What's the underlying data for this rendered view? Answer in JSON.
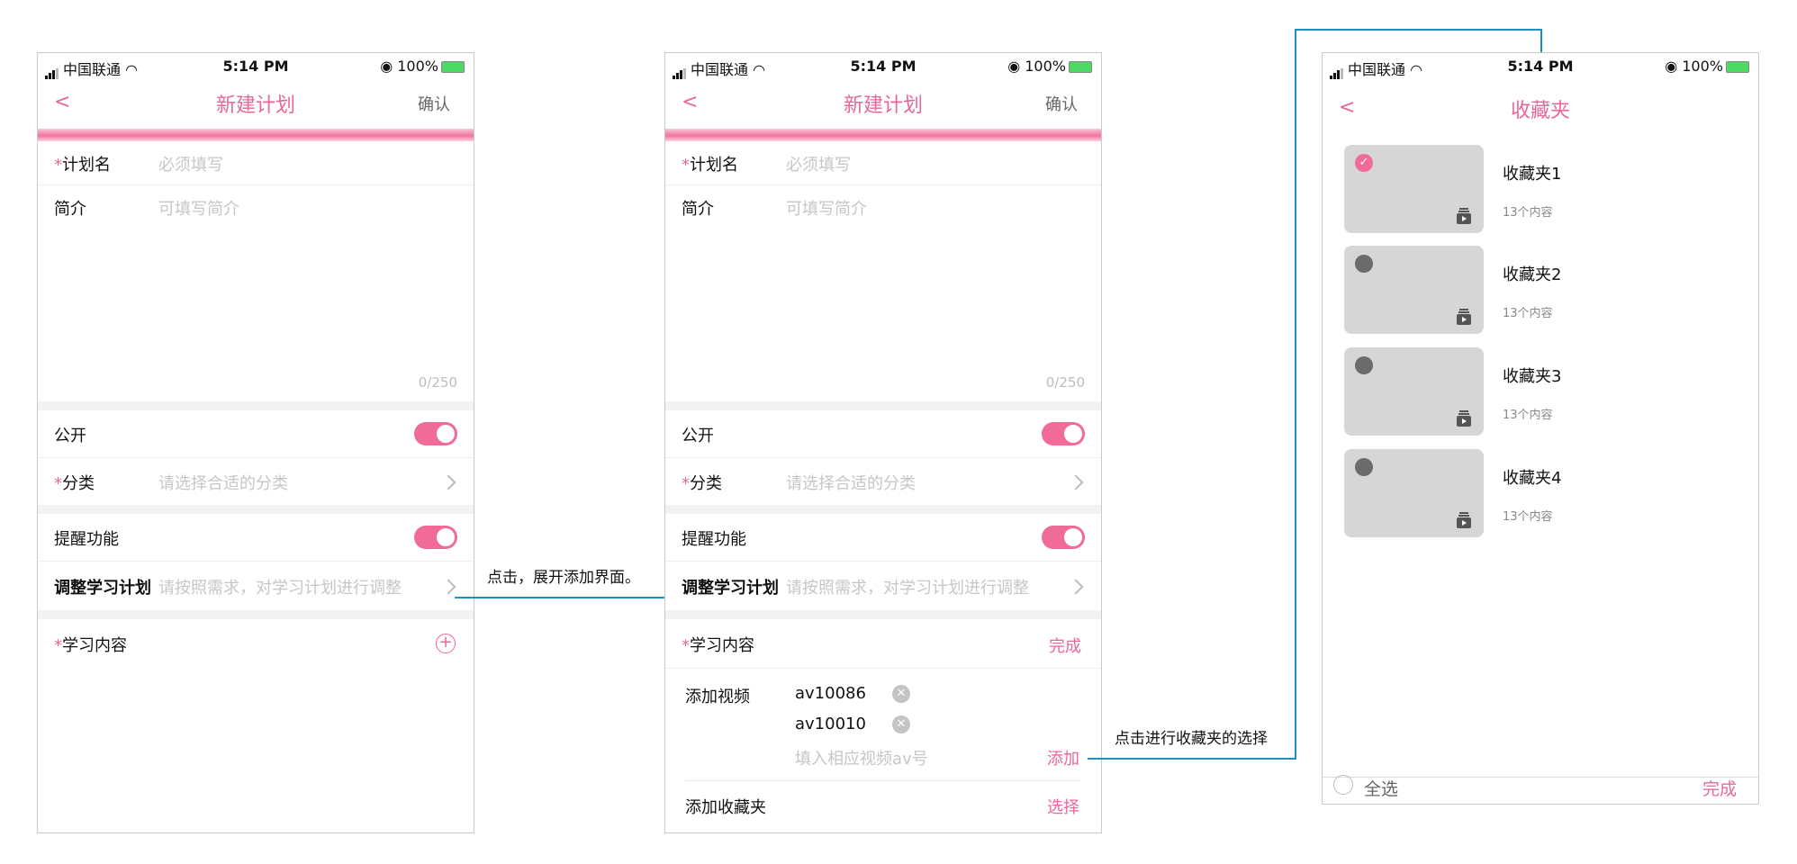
{
  "status_bar": {
    "carrier": "中国联通",
    "time": "5:14 PM",
    "battery": "100%"
  },
  "screen1": {
    "title": "新建计划",
    "confirm": "确认",
    "plan_name_label": "计划名",
    "plan_name_placeholder": "必须填写",
    "intro_label": "简介",
    "intro_placeholder": "可填写简介",
    "counter": "0/250",
    "public_label": "公开",
    "category_label": "分类",
    "category_placeholder": "请选择合适的分类",
    "reminder_label": "提醒功能",
    "adjust_label": "调整学习计划",
    "adjust_placeholder": "请按照需求，对学习计划进行调整",
    "content_label": "学习内容"
  },
  "screen2": {
    "title": "新建计划",
    "confirm": "确认",
    "plan_name_label": "计划名",
    "plan_name_placeholder": "必须填写",
    "intro_label": "简介",
    "intro_placeholder": "可填写简介",
    "counter": "0/250",
    "public_label": "公开",
    "category_label": "分类",
    "category_placeholder": "请选择合适的分类",
    "reminder_label": "提醒功能",
    "adjust_label": "调整学习计划",
    "adjust_placeholder": "请按照需求，对学习计划进行调整",
    "content_label": "学习内容",
    "done": "完成",
    "add_video_label": "添加视频",
    "videos": [
      "av10086",
      "av10010"
    ],
    "video_input_placeholder": "填入相应视频av号",
    "add": "添加",
    "add_folder_label": "添加收藏夹",
    "select": "选择"
  },
  "screen3": {
    "title": "收藏夹",
    "folders": [
      {
        "name": "收藏夹1",
        "count": "13个内容"
      },
      {
        "name": "收藏夹2",
        "count": "13个内容"
      },
      {
        "name": "收藏夹3",
        "count": "13个内容"
      },
      {
        "name": "收藏夹4",
        "count": "13个内容"
      }
    ],
    "select_all": "全选",
    "done": "完成"
  },
  "annotations": {
    "expand": "点击，展开添加界面。",
    "select_folder": "点击进行收藏夹的选择"
  },
  "colors": {
    "accent": "#e8679a",
    "connector": "#1f8fbf"
  }
}
